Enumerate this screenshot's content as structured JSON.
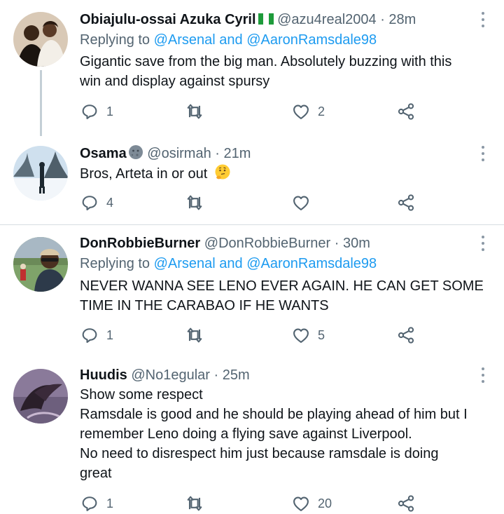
{
  "tweets": [
    {
      "name": "Obiajulu-ossai Azuka Cyril",
      "handle": "@azu4real2004",
      "sep": "·",
      "time": "28m",
      "reply_prefix": "Replying to",
      "reply_mentions": "@Arsenal and @AaronRamsdale98",
      "text_lines": [
        "Gigantic save from the big man. Absolutely buzzing with this",
        "win and display against spursy"
      ],
      "replies": "1",
      "retweets": "",
      "likes": "2"
    },
    {
      "name": "Osama",
      "handle": "@osirmah",
      "sep": "·",
      "time": "21m",
      "text_lines": [
        "Bros, Arteta in or out"
      ],
      "replies": "4",
      "retweets": "",
      "likes": ""
    },
    {
      "name": "DonRobbieBurner",
      "handle": "@DonRobbieBurner",
      "sep": "·",
      "time": "30m",
      "reply_prefix": "Replying to",
      "reply_mentions": "@Arsenal and @AaronRamsdale98",
      "text_lines": [
        "NEVER WANNA SEE LENO EVER AGAIN. HE CAN GET SOME",
        "TIME IN THE CARABAO IF HE WANTS"
      ],
      "replies": "1",
      "retweets": "",
      "likes": "5"
    },
    {
      "name": "Huudis",
      "handle": "@No1egular",
      "sep": "·",
      "time": "25m",
      "text_lines": [
        "Show some respect",
        "Ramsdale is good and he should be playing ahead of him but I",
        "remember Leno doing a flying save against Liverpool.",
        "No need to disrespect him just because ramsdale is doing",
        "great"
      ],
      "replies": "1",
      "retweets": "",
      "likes": "20"
    }
  ],
  "icons": {
    "reply": "reply-icon",
    "retweet": "retweet-icon",
    "like": "like-icon",
    "share": "share-icon",
    "more": "more-options-icon",
    "flag": "nigeria-flag-icon",
    "moon": "new-moon-face-icon",
    "thinking": "thinking-face-icon"
  },
  "colors": {
    "name": "#0f1419",
    "secondary": "#536471",
    "mention": "#1d9bf0",
    "separator": "#d7dde1"
  }
}
